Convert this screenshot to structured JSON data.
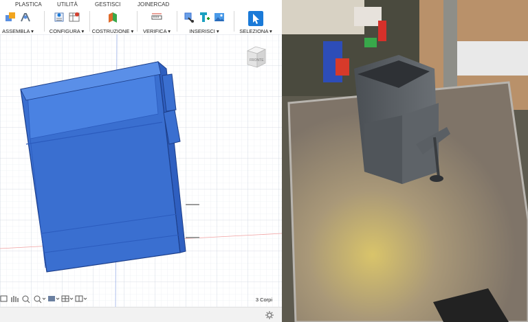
{
  "toolbar": {
    "tabs": [
      "PLASTICA",
      "UTILITÀ",
      "GESTISCI",
      "JOINERCAD"
    ],
    "groups": [
      {
        "label": "ASSEMBLA ▾"
      },
      {
        "label": "CONFIGURA ▾"
      },
      {
        "label": "COSTRUZIONE ▾"
      },
      {
        "label": "VERIFICA ▾"
      },
      {
        "label": "INSERISCI ▾"
      },
      {
        "label": "SELEZIONA ▾"
      }
    ]
  },
  "viewcube": {
    "face_label": "FRONTE"
  },
  "status": {
    "bodies_count": "3 Corpi"
  },
  "icons": {
    "assembla": [
      "new-component-icon",
      "joint-icon"
    ],
    "configura": [
      "parameters-icon",
      "table-icon"
    ],
    "costruzione": [
      "offset-plane-icon"
    ],
    "verifica": [
      "measure-icon"
    ],
    "inserisci": [
      "insert-derive-icon",
      "insert-mesh-icon",
      "insert-image-icon"
    ],
    "seleziona": [
      "select-arrow-icon"
    ],
    "bottom": [
      "display-settings-icon",
      "pan-icon",
      "zoom-icon",
      "fit-icon",
      "visual-style-icon",
      "grid-icon",
      "viewports-icon"
    ],
    "settings": "gear-icon"
  },
  "colors": {
    "model": "#3a6fd0",
    "accent": "#1a7ad8"
  }
}
